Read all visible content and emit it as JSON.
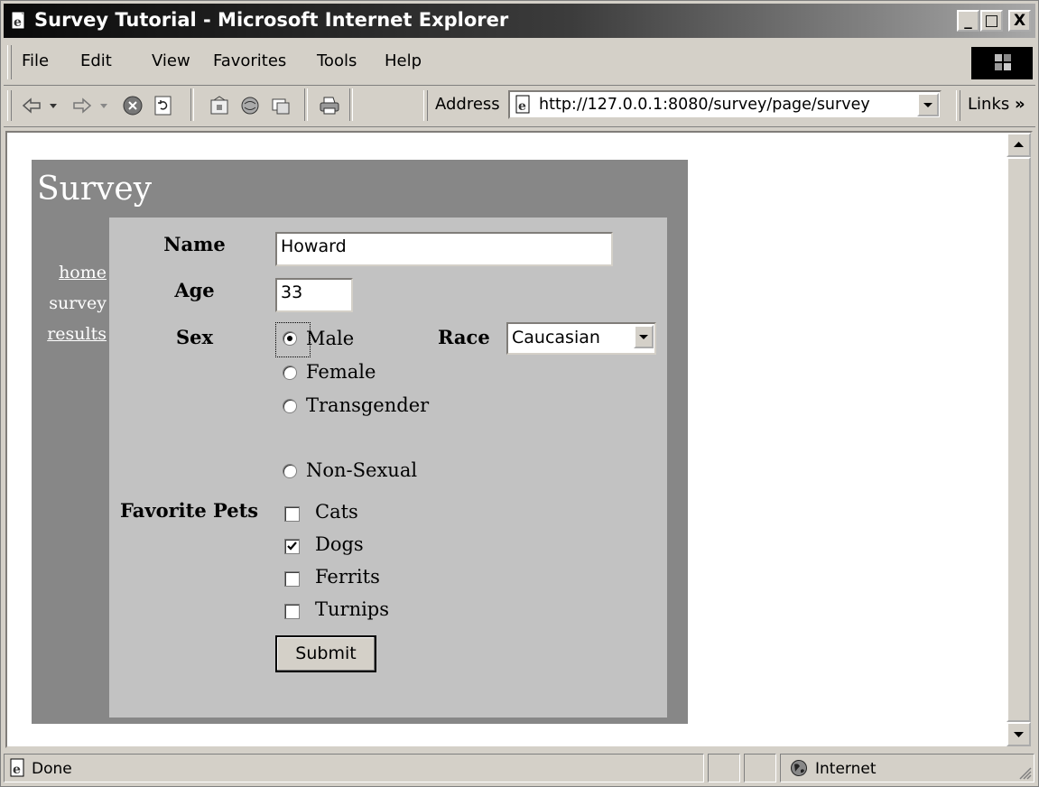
{
  "window": {
    "title": "Survey Tutorial - Microsoft Internet Explorer",
    "buttons": {
      "minimize": "_",
      "maximize": "□",
      "close": "X"
    }
  },
  "menu": {
    "items": [
      "File",
      "Edit",
      "View",
      "Favorites",
      "Tools",
      "Help"
    ]
  },
  "toolbar": {
    "address_label": "Address",
    "url": "http://127.0.0.1:8080/survey/page/survey",
    "links_label": "Links",
    "links_chevron": "»"
  },
  "page": {
    "title": "Survey",
    "nav": [
      {
        "label": "home",
        "link": true
      },
      {
        "label": "survey",
        "link": false
      },
      {
        "label": "results",
        "link": true
      }
    ],
    "form": {
      "name_label": "Name",
      "name_value": "Howard",
      "age_label": "Age",
      "age_value": "33",
      "sex_label": "Sex",
      "sex_options": [
        {
          "label": "Male",
          "selected": true
        },
        {
          "label": "Female",
          "selected": false
        },
        {
          "label": "Transgender",
          "selected": false
        },
        {
          "label": "Non-Sexual",
          "selected": false
        }
      ],
      "race_label": "Race",
      "race_value": "Caucasian",
      "pets_label": "Favorite Pets",
      "pets": [
        {
          "label": "Cats",
          "checked": false
        },
        {
          "label": "Dogs",
          "checked": true
        },
        {
          "label": "Ferrits",
          "checked": false
        },
        {
          "label": "Turnips",
          "checked": false
        }
      ],
      "submit_label": "Submit"
    }
  },
  "status": {
    "text": "Done",
    "zone": "Internet"
  }
}
